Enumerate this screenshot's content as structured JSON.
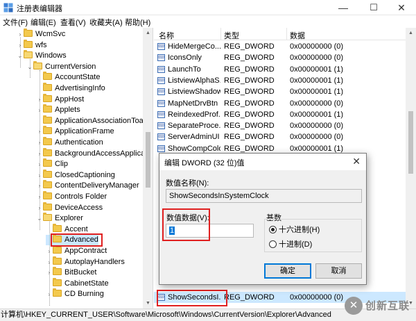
{
  "window": {
    "title": "注册表编辑器",
    "minimize_glyph": "—",
    "maximize_glyph": "☐",
    "close_glyph": "✕"
  },
  "menu": [
    "文件(F)",
    "编辑(E)",
    "查看(V)",
    "收藏夹(A)",
    "帮助(H)"
  ],
  "tree": [
    {
      "label": "WcmSvc",
      "indent": 1,
      "expander": "›"
    },
    {
      "label": "wfs",
      "indent": 1,
      "expander": "›"
    },
    {
      "label": "Windows",
      "indent": 1,
      "expander": "⌄",
      "open": true
    },
    {
      "label": "CurrentVersion",
      "indent": 2,
      "expander": "⌄",
      "open": true
    },
    {
      "label": "AccountState",
      "indent": 3,
      "expander": ""
    },
    {
      "label": "AdvertisingInfo",
      "indent": 3,
      "expander": ""
    },
    {
      "label": "AppHost",
      "indent": 3,
      "expander": "›"
    },
    {
      "label": "Applets",
      "indent": 3,
      "expander": "›"
    },
    {
      "label": "ApplicationAssociationToast",
      "indent": 3,
      "expander": ""
    },
    {
      "label": "ApplicationFrame",
      "indent": 3,
      "expander": "›"
    },
    {
      "label": "Authentication",
      "indent": 3,
      "expander": "›"
    },
    {
      "label": "BackgroundAccessApplicati",
      "indent": 3,
      "expander": "›"
    },
    {
      "label": "Clip",
      "indent": 3,
      "expander": "›"
    },
    {
      "label": "ClosedCaptioning",
      "indent": 3,
      "expander": "›"
    },
    {
      "label": "ContentDeliveryManager",
      "indent": 3,
      "expander": "›"
    },
    {
      "label": "Controls Folder",
      "indent": 3,
      "expander": "›"
    },
    {
      "label": "DeviceAccess",
      "indent": 3,
      "expander": "›"
    },
    {
      "label": "Explorer",
      "indent": 3,
      "expander": "⌄",
      "open": true
    },
    {
      "label": "Accent",
      "indent": 4,
      "expander": ""
    },
    {
      "label": "Advanced",
      "indent": 4,
      "expander": "",
      "selected": true
    },
    {
      "label": "AppContract",
      "indent": 4,
      "expander": "›"
    },
    {
      "label": "AutoplayHandlers",
      "indent": 4,
      "expander": "›"
    },
    {
      "label": "BitBucket",
      "indent": 4,
      "expander": "›"
    },
    {
      "label": "CabinetState",
      "indent": 4,
      "expander": ""
    },
    {
      "label": "CD Burning",
      "indent": 4,
      "expander": "›"
    }
  ],
  "list": {
    "headers": {
      "name": "名称",
      "type": "类型",
      "data": "数据"
    },
    "rows": [
      {
        "name": "HideMergeCo...",
        "type": "REG_DWORD",
        "data": "0x00000000 (0)"
      },
      {
        "name": "IconsOnly",
        "type": "REG_DWORD",
        "data": "0x00000000 (0)"
      },
      {
        "name": "LaunchTo",
        "type": "REG_DWORD",
        "data": "0x00000001 (1)"
      },
      {
        "name": "ListviewAlphaS...",
        "type": "REG_DWORD",
        "data": "0x00000001 (1)"
      },
      {
        "name": "ListviewShadow",
        "type": "REG_DWORD",
        "data": "0x00000001 (1)"
      },
      {
        "name": "MapNetDrvBtn",
        "type": "REG_DWORD",
        "data": "0x00000000 (0)"
      },
      {
        "name": "ReindexedProf...",
        "type": "REG_DWORD",
        "data": "0x00000001 (1)"
      },
      {
        "name": "SeparateProce...",
        "type": "REG_DWORD",
        "data": "0x00000000 (0)"
      },
      {
        "name": "ServerAdminUI",
        "type": "REG_DWORD",
        "data": "0x00000000 (0)"
      },
      {
        "name": "ShowCompColor",
        "type": "REG_DWORD",
        "data": "0x00000001 (1)"
      }
    ],
    "bottom_row": {
      "name": "ShowSecondsI...",
      "type": "REG_DWORD",
      "data": "0x00000000 (0)"
    }
  },
  "status": "计算机\\HKEY_CURRENT_USER\\Software\\Microsoft\\Windows\\CurrentVersion\\Explorer\\Advanced",
  "dialog": {
    "title": "编辑 DWORD (32 位)值",
    "name_label": "数值名称(N):",
    "name_value": "ShowSecondsInSystemClock",
    "data_label": "数值数据(V):",
    "data_value": "1",
    "base_label": "基数",
    "hex_label": "十六进制(H)",
    "dec_label": "十进制(D)",
    "base_selected": "hex",
    "ok_label": "确定",
    "cancel_label": "取消"
  },
  "watermark": {
    "glyph": "✕",
    "text": "创新互联"
  },
  "colors": {
    "highlight": "#e02020",
    "selection": "#cce8ff",
    "accent": "#0078d7"
  }
}
